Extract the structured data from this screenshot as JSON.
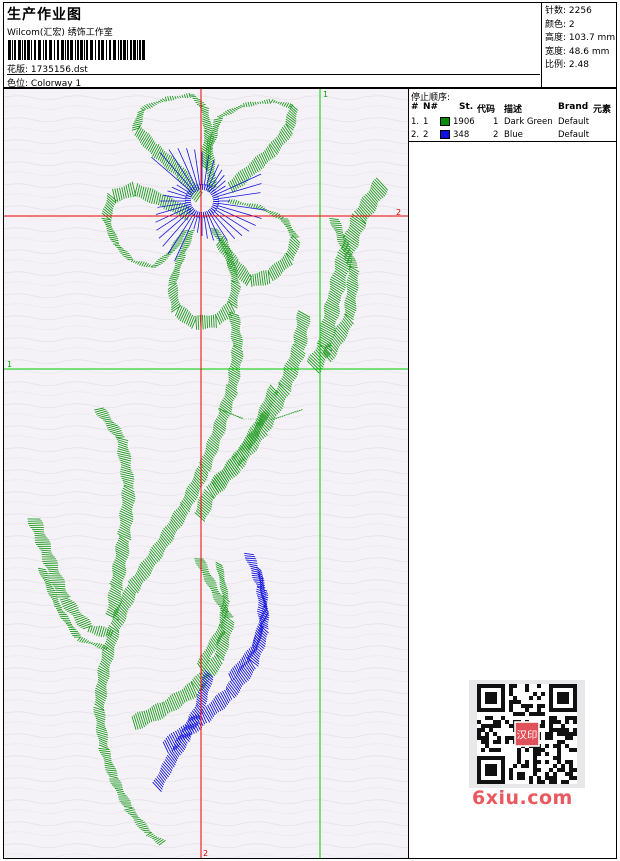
{
  "header": {
    "title": "生产作业图",
    "subtitle": "Wilcom(汇宏) 绣饰工作室",
    "design_label": "花版:",
    "design_value": "1735156.dst",
    "colorway_label": "色位:",
    "colorway_value": "Colorway 1"
  },
  "stats": {
    "stitches_label": "针数:",
    "stitches_value": "2256",
    "colors_label": "颜色:",
    "colors_value": "2",
    "height_label": "高度:",
    "height_value": "103.7 mm",
    "width_label": "宽度:",
    "width_value": "48.6 mm",
    "scale_label": "比例:",
    "scale_value": "2.48"
  },
  "guides": {
    "green_v_label": "1",
    "green_h_label": "1",
    "red_h_label": "2",
    "red_v_label": "2"
  },
  "stop_sequence": {
    "title": "停止顺序:",
    "columns": [
      "#",
      "N#",
      "St.",
      "代码",
      "描述",
      "Brand",
      "元素"
    ],
    "rows": [
      {
        "num": "1.",
        "n": "1",
        "color": "#0a8a0a",
        "stitches": "1906",
        "code": "1",
        "desc": "Dark Green",
        "brand": "Default"
      },
      {
        "num": "2.",
        "n": "2",
        "color": "#1010e0",
        "stitches": "348",
        "code": "2",
        "desc": "Blue",
        "brand": "Default"
      }
    ]
  },
  "watermark": {
    "text": "6xiu.com",
    "seal_text": "汉印"
  },
  "colors": {
    "thread_green": "#1e9a1e",
    "thread_blue": "#1515dd",
    "guide_green": "#00cc00",
    "guide_red": "#ee0000"
  }
}
